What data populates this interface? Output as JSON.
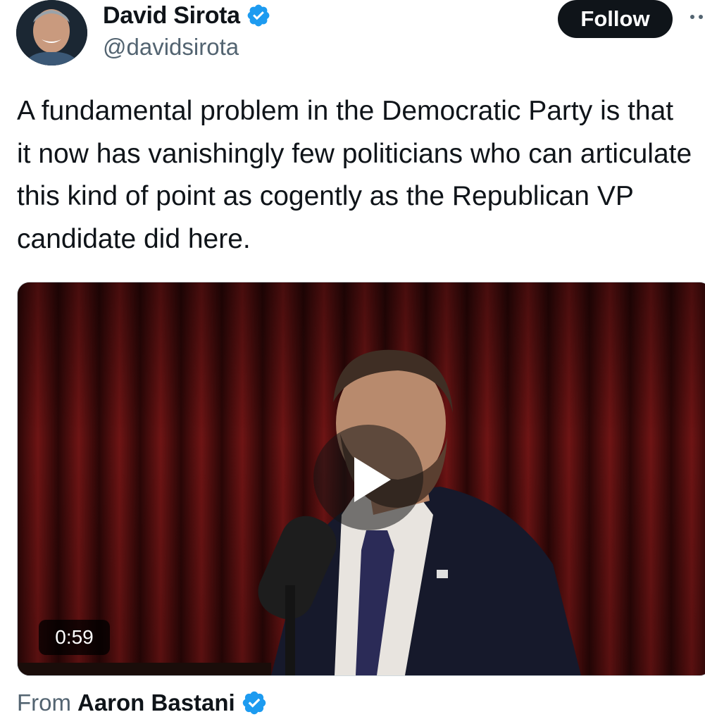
{
  "author": {
    "name": "David Sirota",
    "handle": "@davidsirota",
    "verified": true
  },
  "follow_label": "Follow",
  "more_icon": "more-horizontal-icon",
  "tweet_text": "A fundamental problem in the Democratic Party is that it now has vanishingly few politicians who can articulate this kind of point as cogently as the Republican VP candidate did here.",
  "media": {
    "type": "video",
    "duration": "0:59",
    "play_icon": "play-icon"
  },
  "attribution": {
    "prefix": "From",
    "name": "Aaron Bastani",
    "verified": true
  },
  "colors": {
    "verified_blue": "#1d9bf0",
    "text_primary": "#0f1419",
    "text_secondary": "#536471",
    "follow_bg": "#0f1419"
  }
}
